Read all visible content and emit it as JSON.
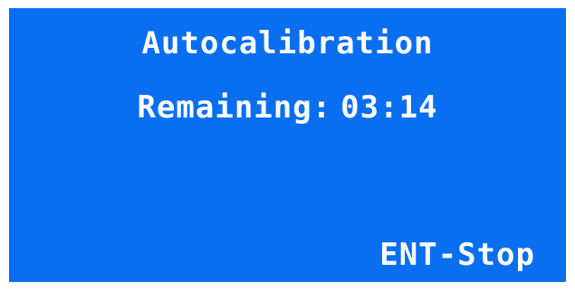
{
  "screen": {
    "background_color": "#0a6ef0",
    "text_color": "#ffffff",
    "title": "Autocalibration",
    "remaining_label": "Remaining:",
    "remaining_time": "03:14",
    "softkey_label": "ENT-Stop"
  }
}
